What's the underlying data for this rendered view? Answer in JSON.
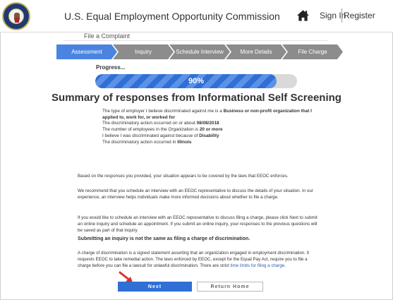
{
  "header": {
    "app_title": "U.S. Equal Employment Opportunity Commission",
    "signin_label": "Sign In",
    "register_label": "Register",
    "logo_icon": "eeoc-seal",
    "home_icon": "home-icon"
  },
  "breadcrumb": {
    "label": "File a Complaint"
  },
  "steps": [
    {
      "label": "Assessment",
      "active": true
    },
    {
      "label": "Inquiry",
      "active": false
    },
    {
      "label": "Schedule Interview",
      "active": false
    },
    {
      "label": "More Details",
      "active": false
    },
    {
      "label": "File Charge",
      "active": false
    }
  ],
  "colors": {
    "active_step": "#4a84e0",
    "inactive_step": "#8c8c8c",
    "accent": "#2f6fd6"
  },
  "progress": {
    "label": "Progress...",
    "value": 0.9,
    "text": "90%"
  },
  "summary": {
    "title": "Summary of responses from Informational Self Screening",
    "facts": [
      {
        "pre": "The type of employer I believe discriminated against me is a ",
        "bold": "Business or non-profit organization that I applied to, work for, or worked for"
      },
      {
        "pre": "The discriminatory action occurred on or about ",
        "bold": "08/08/2018"
      },
      {
        "pre": "The number of employees in the Organization is ",
        "bold": "20 or more"
      },
      {
        "pre": "I believe I was discriminated against because of ",
        "bold": "Disability"
      },
      {
        "pre": "The discriminatory action occurred in ",
        "bold": "Illinois"
      }
    ]
  },
  "paragraphs": {
    "p1": "Based on the responses you provided, your situation appears to be covered by the laws that EEOC enforces.",
    "p2": "We recommend that you schedule an interview with an EEOC representative to discuss the details of your situation. In our experience, an interview helps individuals make more informed decisions about whether to file a charge.",
    "p3": "If you would like to schedule an interview with an EEOC representative to discuss filing a charge, please click Next to submit an online inquiry and schedule an appointment. If you submit an online inquiry, your responses to the previous questions will be saved as part of that inquiry.",
    "p4": "Submitting an inquiry is not the same as filing a charge of discrimination.",
    "p5": "A charge of discrimination is a signed statement asserting that an organization engaged in employment discrimination. It requests EEOC to take remedial action. The laws enforced by EEOC, except for the Equal Pay Act, require you to file a charge before you can file a lawsuit for unlawful discrimination. There are strict ",
    "p5_link": "time limits for filing a charge",
    "p5_end": "."
  },
  "buttons": {
    "next_label": "Next",
    "return_label": "Return Home"
  }
}
